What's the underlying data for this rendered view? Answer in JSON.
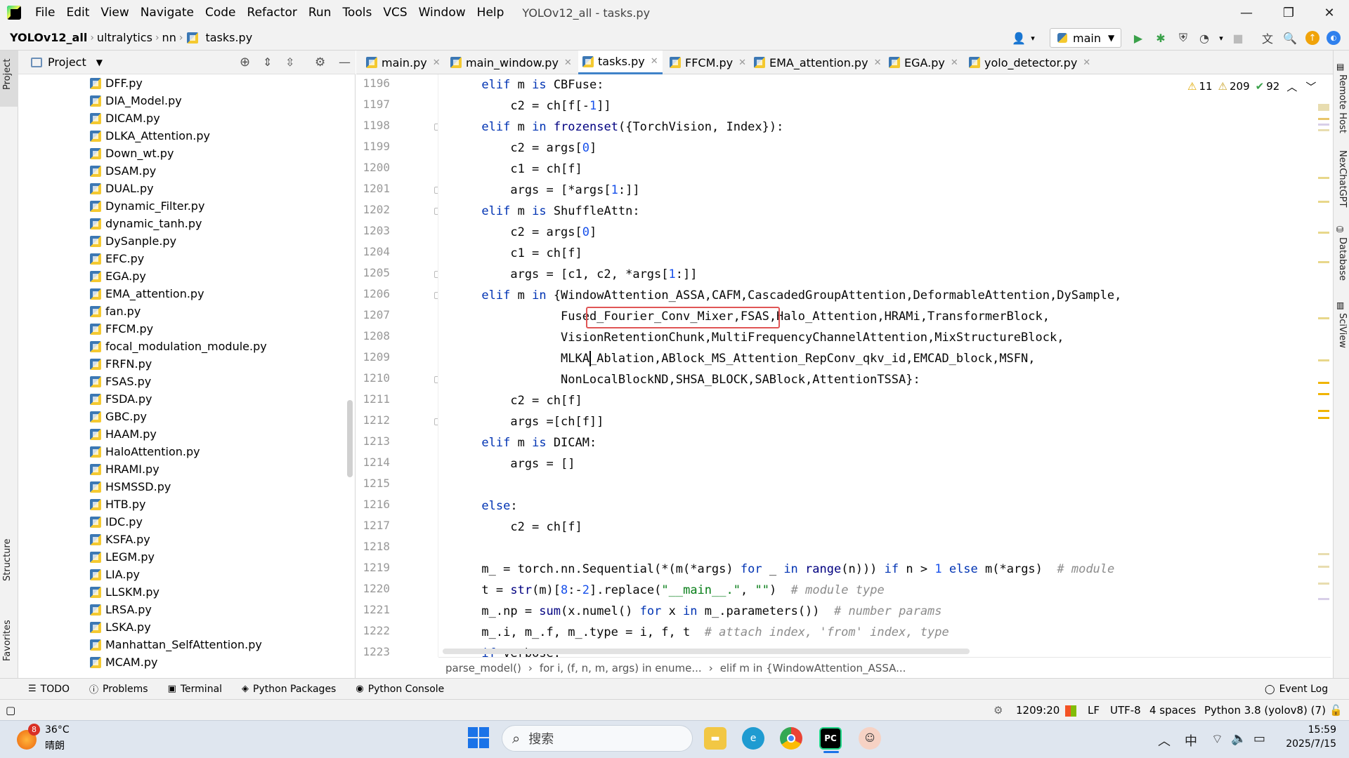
{
  "window": {
    "title": "YOLOv12_all - tasks.py",
    "menu": [
      "File",
      "Edit",
      "View",
      "Navigate",
      "Code",
      "Refactor",
      "Run",
      "Tools",
      "VCS",
      "Window",
      "Help"
    ],
    "minimize": "—",
    "restore": "❐",
    "close": "✕"
  },
  "nav": {
    "crumbs": [
      "YOLOv12_all",
      "ultralytics",
      "nn",
      "tasks.py"
    ],
    "run_config": "main"
  },
  "project_panel": {
    "title": "Project",
    "files": [
      "DFF.py",
      "DIA_Model.py",
      "DICAM.py",
      "DLKA_Attention.py",
      "Down_wt.py",
      "DSAM.py",
      "DUAL.py",
      "Dynamic_Filter.py",
      "dynamic_tanh.py",
      "DySanple.py",
      "EFC.py",
      "EGA.py",
      "EMA_attention.py",
      "fan.py",
      "FFCM.py",
      "focal_modulation_module.py",
      "FRFN.py",
      "FSAS.py",
      "FSDA.py",
      "GBC.py",
      "HAAM.py",
      "HaloAttention.py",
      "HRAMI.py",
      "HSMSSD.py",
      "HTB.py",
      "IDC.py",
      "KSFA.py",
      "LEGM.py",
      "LIA.py",
      "LLSKM.py",
      "LRSA.py",
      "LSKA.py",
      "Manhattan_SelfAttention.py",
      "MCAM.py"
    ]
  },
  "left_strip": {
    "project": "Project",
    "structure": "Structure",
    "favorites": "Favorites"
  },
  "right_strip": {
    "remote_host": "Remote Host",
    "nexchatgpt": "NexChatGPT",
    "database": "Database",
    "sciview": "SciView"
  },
  "tabs": [
    "main.py",
    "main_window.py",
    "tasks.py",
    "FFCM.py",
    "EMA_attention.py",
    "EGA.py",
    "yolo_detector.py"
  ],
  "inspections": {
    "warnings": "11",
    "weak_warnings": "209",
    "typos": "92"
  },
  "editor": {
    "line_numbers": [
      "1196",
      "1197",
      "1198",
      "1199",
      "1200",
      "1201",
      "1202",
      "1203",
      "1204",
      "1205",
      "1206",
      "1207",
      "1208",
      "1209",
      "1210",
      "1211",
      "1212",
      "1213",
      "1214",
      "1215",
      "1216",
      "1217",
      "1218",
      "1219",
      "1220",
      "1221",
      "1222",
      "1223"
    ],
    "highlighted_name": "Fused_Fourier_Conv_Mixer"
  },
  "code_breadcrumbs": [
    "parse_model()",
    "for i, (f, n, m, args) in enume...",
    "elif m in {WindowAttention_ASSA..."
  ],
  "tool_tabs": [
    "TODO",
    "Problems",
    "Terminal",
    "Python Packages",
    "Python Console"
  ],
  "event_log": "Event Log",
  "status": {
    "position": "1209:20",
    "line_sep": "LF",
    "encoding": "UTF-8",
    "indent": "4 spaces",
    "interpreter": "Python 3.8 (yolov8) (7)"
  },
  "taskbar": {
    "weather_badge": "8",
    "temperature": "36°C",
    "weather": "晴朗",
    "search_placeholder": "搜索",
    "ime": "中",
    "time": "15:59",
    "date": "2025/7/15"
  }
}
